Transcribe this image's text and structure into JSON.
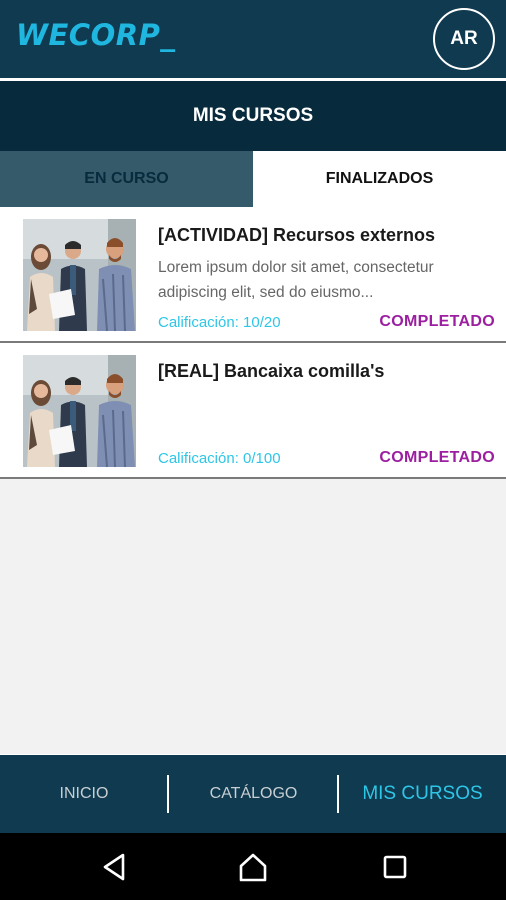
{
  "header": {
    "logo": "WECORP_",
    "avatar_initials": "AR"
  },
  "page": {
    "title": "MIS CURSOS"
  },
  "tabs": [
    {
      "label": "EN CURSO",
      "active": false
    },
    {
      "label": "FINALIZADOS",
      "active": true
    }
  ],
  "courses": [
    {
      "title": "[ACTIVIDAD] Recursos externos",
      "description": "Lorem ipsum dolor sit amet, consectetur adipiscing elit, sed do eiusmo...",
      "grade": "Calificación: 10/20",
      "status": "COMPLETADO"
    },
    {
      "title": "[REAL] Bancaixa comilla's",
      "description": "",
      "grade": "Calificación: 0/100",
      "status": "COMPLETADO"
    }
  ],
  "bottom_nav": [
    {
      "label": "INICIO",
      "active": false
    },
    {
      "label": "CATÁLOGO",
      "active": false
    },
    {
      "label": "MIS CURSOS",
      "active": true
    }
  ],
  "system_nav": {
    "icons": [
      "back-icon",
      "home-icon",
      "recents-icon"
    ]
  },
  "colors": {
    "header_bg": "#0f3a50",
    "title_bg": "#072b3d",
    "accent_cyan": "#2ec6e6",
    "status_purple": "#9b1fa0",
    "logo_cyan": "#1fb6e0"
  }
}
